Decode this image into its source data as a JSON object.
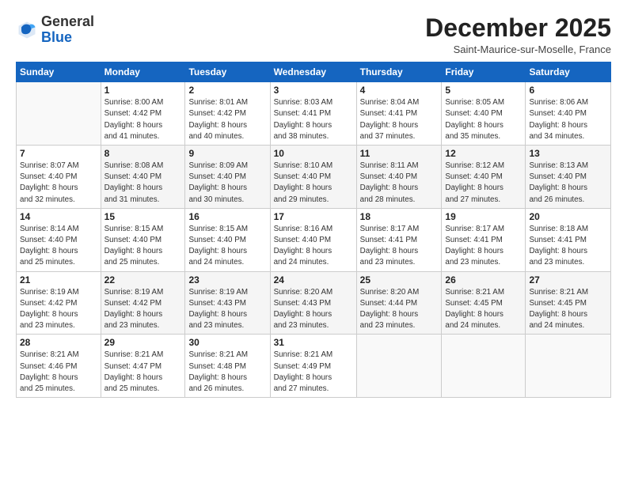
{
  "header": {
    "logo_general": "General",
    "logo_blue": "Blue",
    "month_title": "December 2025",
    "location": "Saint-Maurice-sur-Moselle, France"
  },
  "days_of_week": [
    "Sunday",
    "Monday",
    "Tuesday",
    "Wednesday",
    "Thursday",
    "Friday",
    "Saturday"
  ],
  "weeks": [
    [
      {
        "day": "",
        "info": ""
      },
      {
        "day": "1",
        "info": "Sunrise: 8:00 AM\nSunset: 4:42 PM\nDaylight: 8 hours\nand 41 minutes."
      },
      {
        "day": "2",
        "info": "Sunrise: 8:01 AM\nSunset: 4:42 PM\nDaylight: 8 hours\nand 40 minutes."
      },
      {
        "day": "3",
        "info": "Sunrise: 8:03 AM\nSunset: 4:41 PM\nDaylight: 8 hours\nand 38 minutes."
      },
      {
        "day": "4",
        "info": "Sunrise: 8:04 AM\nSunset: 4:41 PM\nDaylight: 8 hours\nand 37 minutes."
      },
      {
        "day": "5",
        "info": "Sunrise: 8:05 AM\nSunset: 4:40 PM\nDaylight: 8 hours\nand 35 minutes."
      },
      {
        "day": "6",
        "info": "Sunrise: 8:06 AM\nSunset: 4:40 PM\nDaylight: 8 hours\nand 34 minutes."
      }
    ],
    [
      {
        "day": "7",
        "info": "Sunrise: 8:07 AM\nSunset: 4:40 PM\nDaylight: 8 hours\nand 32 minutes."
      },
      {
        "day": "8",
        "info": "Sunrise: 8:08 AM\nSunset: 4:40 PM\nDaylight: 8 hours\nand 31 minutes."
      },
      {
        "day": "9",
        "info": "Sunrise: 8:09 AM\nSunset: 4:40 PM\nDaylight: 8 hours\nand 30 minutes."
      },
      {
        "day": "10",
        "info": "Sunrise: 8:10 AM\nSunset: 4:40 PM\nDaylight: 8 hours\nand 29 minutes."
      },
      {
        "day": "11",
        "info": "Sunrise: 8:11 AM\nSunset: 4:40 PM\nDaylight: 8 hours\nand 28 minutes."
      },
      {
        "day": "12",
        "info": "Sunrise: 8:12 AM\nSunset: 4:40 PM\nDaylight: 8 hours\nand 27 minutes."
      },
      {
        "day": "13",
        "info": "Sunrise: 8:13 AM\nSunset: 4:40 PM\nDaylight: 8 hours\nand 26 minutes."
      }
    ],
    [
      {
        "day": "14",
        "info": "Sunrise: 8:14 AM\nSunset: 4:40 PM\nDaylight: 8 hours\nand 25 minutes."
      },
      {
        "day": "15",
        "info": "Sunrise: 8:15 AM\nSunset: 4:40 PM\nDaylight: 8 hours\nand 25 minutes."
      },
      {
        "day": "16",
        "info": "Sunrise: 8:15 AM\nSunset: 4:40 PM\nDaylight: 8 hours\nand 24 minutes."
      },
      {
        "day": "17",
        "info": "Sunrise: 8:16 AM\nSunset: 4:40 PM\nDaylight: 8 hours\nand 24 minutes."
      },
      {
        "day": "18",
        "info": "Sunrise: 8:17 AM\nSunset: 4:41 PM\nDaylight: 8 hours\nand 23 minutes."
      },
      {
        "day": "19",
        "info": "Sunrise: 8:17 AM\nSunset: 4:41 PM\nDaylight: 8 hours\nand 23 minutes."
      },
      {
        "day": "20",
        "info": "Sunrise: 8:18 AM\nSunset: 4:41 PM\nDaylight: 8 hours\nand 23 minutes."
      }
    ],
    [
      {
        "day": "21",
        "info": "Sunrise: 8:19 AM\nSunset: 4:42 PM\nDaylight: 8 hours\nand 23 minutes."
      },
      {
        "day": "22",
        "info": "Sunrise: 8:19 AM\nSunset: 4:42 PM\nDaylight: 8 hours\nand 23 minutes."
      },
      {
        "day": "23",
        "info": "Sunrise: 8:19 AM\nSunset: 4:43 PM\nDaylight: 8 hours\nand 23 minutes."
      },
      {
        "day": "24",
        "info": "Sunrise: 8:20 AM\nSunset: 4:43 PM\nDaylight: 8 hours\nand 23 minutes."
      },
      {
        "day": "25",
        "info": "Sunrise: 8:20 AM\nSunset: 4:44 PM\nDaylight: 8 hours\nand 23 minutes."
      },
      {
        "day": "26",
        "info": "Sunrise: 8:21 AM\nSunset: 4:45 PM\nDaylight: 8 hours\nand 24 minutes."
      },
      {
        "day": "27",
        "info": "Sunrise: 8:21 AM\nSunset: 4:45 PM\nDaylight: 8 hours\nand 24 minutes."
      }
    ],
    [
      {
        "day": "28",
        "info": "Sunrise: 8:21 AM\nSunset: 4:46 PM\nDaylight: 8 hours\nand 25 minutes."
      },
      {
        "day": "29",
        "info": "Sunrise: 8:21 AM\nSunset: 4:47 PM\nDaylight: 8 hours\nand 25 minutes."
      },
      {
        "day": "30",
        "info": "Sunrise: 8:21 AM\nSunset: 4:48 PM\nDaylight: 8 hours\nand 26 minutes."
      },
      {
        "day": "31",
        "info": "Sunrise: 8:21 AM\nSunset: 4:49 PM\nDaylight: 8 hours\nand 27 minutes."
      },
      {
        "day": "",
        "info": ""
      },
      {
        "day": "",
        "info": ""
      },
      {
        "day": "",
        "info": ""
      }
    ]
  ]
}
